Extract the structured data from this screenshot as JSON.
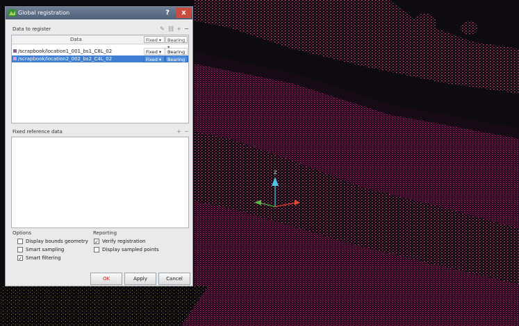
{
  "window": {
    "title": "Global registration",
    "help_glyph": "?",
    "close_glyph": "x"
  },
  "data_section": {
    "label": "Data to register",
    "column_header": "Data",
    "header_combo_1": "Fixed",
    "header_combo_2": "Bearing",
    "rows": [
      {
        "name": "/scrapbook/location1_001_bs1_C8L_02",
        "mode": "Fixed",
        "reference": "Bearing",
        "selected": false,
        "icon_color": "#8a5a9a"
      },
      {
        "name": "/scrapbook/location2_002_bs2_C4L_02",
        "mode": "Fixed",
        "reference": "Bearing",
        "selected": true,
        "icon_color": "#8a5a9a"
      }
    ]
  },
  "fixed_section": {
    "label": "Fixed reference data"
  },
  "options": {
    "label": "Options",
    "items": [
      {
        "label": "Display bounds geometry",
        "checked": false
      },
      {
        "label": "Smart sampling",
        "checked": false
      },
      {
        "label": "Smart filtering",
        "checked": true
      }
    ]
  },
  "reporting": {
    "label": "Reporting",
    "items": [
      {
        "label": "Verify registration",
        "checked": true
      },
      {
        "label": "Display sampled points",
        "checked": false
      }
    ]
  },
  "buttons": {
    "ok": "OK",
    "apply": "Apply",
    "cancel": "Cancel"
  },
  "gizmo": {
    "z_label": "Z"
  },
  "colors": {
    "point_cloud": "#c0307a",
    "title_bar": "#5a6c85",
    "selection": "#3f7ed2",
    "ok_text": "#d42020"
  }
}
